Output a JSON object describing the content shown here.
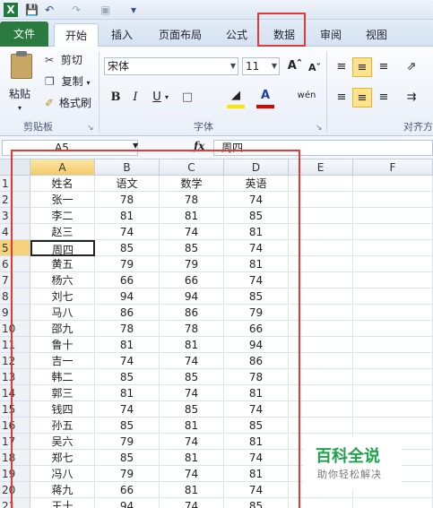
{
  "qat": {
    "icons": [
      "app-icon",
      "save-icon",
      "undo-icon",
      "redo-icon",
      "more-icon"
    ]
  },
  "tabs": [
    {
      "label": "文件"
    },
    {
      "label": "开始"
    },
    {
      "label": "插入"
    },
    {
      "label": "页面布局"
    },
    {
      "label": "公式"
    },
    {
      "label": "数据"
    },
    {
      "label": "审阅"
    },
    {
      "label": "视图"
    }
  ],
  "ribbon": {
    "clipboard": {
      "paste": "粘贴",
      "cut": "剪切",
      "copy": "复制",
      "format_painter": "格式刷",
      "label": "剪贴板"
    },
    "font": {
      "name": "宋体",
      "size": "11",
      "label": "字体",
      "bold": "B",
      "italic": "I",
      "underline": "U",
      "wen": "wén"
    },
    "align": {
      "label": "对齐方"
    }
  },
  "formula_bar": {
    "name_box": "A5",
    "fx": "fx",
    "value": "周四"
  },
  "sheet": {
    "columns": [
      "A",
      "B",
      "C",
      "D",
      "E",
      "F"
    ],
    "rows": [
      [
        "1",
        "姓名",
        "语文",
        "数学",
        "英语"
      ],
      [
        "2",
        "张一",
        "78",
        "78",
        "74"
      ],
      [
        "3",
        "李二",
        "81",
        "81",
        "85"
      ],
      [
        "4",
        "赵三",
        "74",
        "74",
        "81"
      ],
      [
        "5",
        "周四",
        "85",
        "85",
        "74"
      ],
      [
        "6",
        "黄五",
        "79",
        "79",
        "81"
      ],
      [
        "7",
        "杨六",
        "66",
        "66",
        "74"
      ],
      [
        "8",
        "刘七",
        "94",
        "94",
        "85"
      ],
      [
        "9",
        "马八",
        "86",
        "86",
        "79"
      ],
      [
        "10",
        "邵九",
        "78",
        "78",
        "66"
      ],
      [
        "11",
        "鲁十",
        "81",
        "81",
        "94"
      ],
      [
        "12",
        "吉一",
        "74",
        "74",
        "86"
      ],
      [
        "13",
        "韩二",
        "85",
        "85",
        "78"
      ],
      [
        "14",
        "郭三",
        "81",
        "74",
        "81"
      ],
      [
        "15",
        "钱四",
        "74",
        "85",
        "74"
      ],
      [
        "16",
        "孙五",
        "85",
        "81",
        "85"
      ],
      [
        "17",
        "吴六",
        "79",
        "74",
        "81"
      ],
      [
        "18",
        "郑七",
        "85",
        "81",
        "74"
      ],
      [
        "19",
        "冯八",
        "79",
        "74",
        "81"
      ],
      [
        "20",
        "蒋九",
        "66",
        "81",
        "74"
      ],
      [
        "21",
        "王十",
        "94",
        "74",
        "85"
      ]
    ]
  },
  "watermark": {
    "title": "百科全说",
    "subtitle": "助你轻松解决"
  },
  "colors": {
    "file_tab": "#2b7a3f",
    "highlight": "#e53935",
    "selection": "#f4ca68"
  }
}
